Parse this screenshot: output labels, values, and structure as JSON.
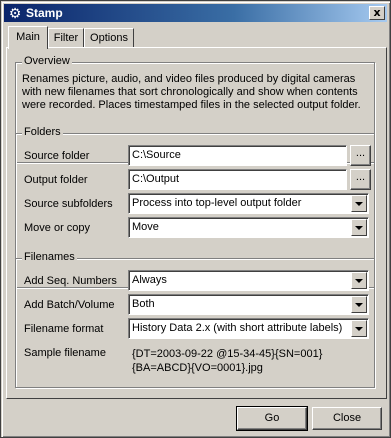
{
  "window": {
    "title": "Stamp",
    "icon": "gear-icon",
    "close_label": "x"
  },
  "tabs": [
    {
      "label": "Main",
      "active": true
    },
    {
      "label": "Filter",
      "active": false
    },
    {
      "label": "Options",
      "active": false
    }
  ],
  "overview": {
    "title": "Overview",
    "text": "Renames picture, audio, and video files produced by digital cameras with new filenames that sort chronologically and show when contents were recorded. Places timestamped files in the selected output folder."
  },
  "folders": {
    "title": "Folders",
    "source_label": "Source folder",
    "source_value": "C:\\Source",
    "output_label": "Output folder",
    "output_value": "C:\\Output",
    "subfolders_label": "Source subfolders",
    "subfolders_value": "Process into top-level output folder",
    "move_label": "Move or copy",
    "move_value": "Move",
    "browse_label": "..."
  },
  "filenames": {
    "title": "Filenames",
    "seq_label": "Add Seq. Numbers",
    "seq_value": "Always",
    "batch_label": "Add Batch/Volume",
    "batch_value": "Both",
    "format_label": "Filename format",
    "format_value": "History Data 2.x (with short attribute labels)",
    "sample_label": "Sample filename",
    "sample_line1": "{DT=2003-09-22 @15-34-45}{SN=001}",
    "sample_line2": "{BA=ABCD}{VO=0001}.jpg"
  },
  "buttons": {
    "go": "Go",
    "close": "Close"
  }
}
